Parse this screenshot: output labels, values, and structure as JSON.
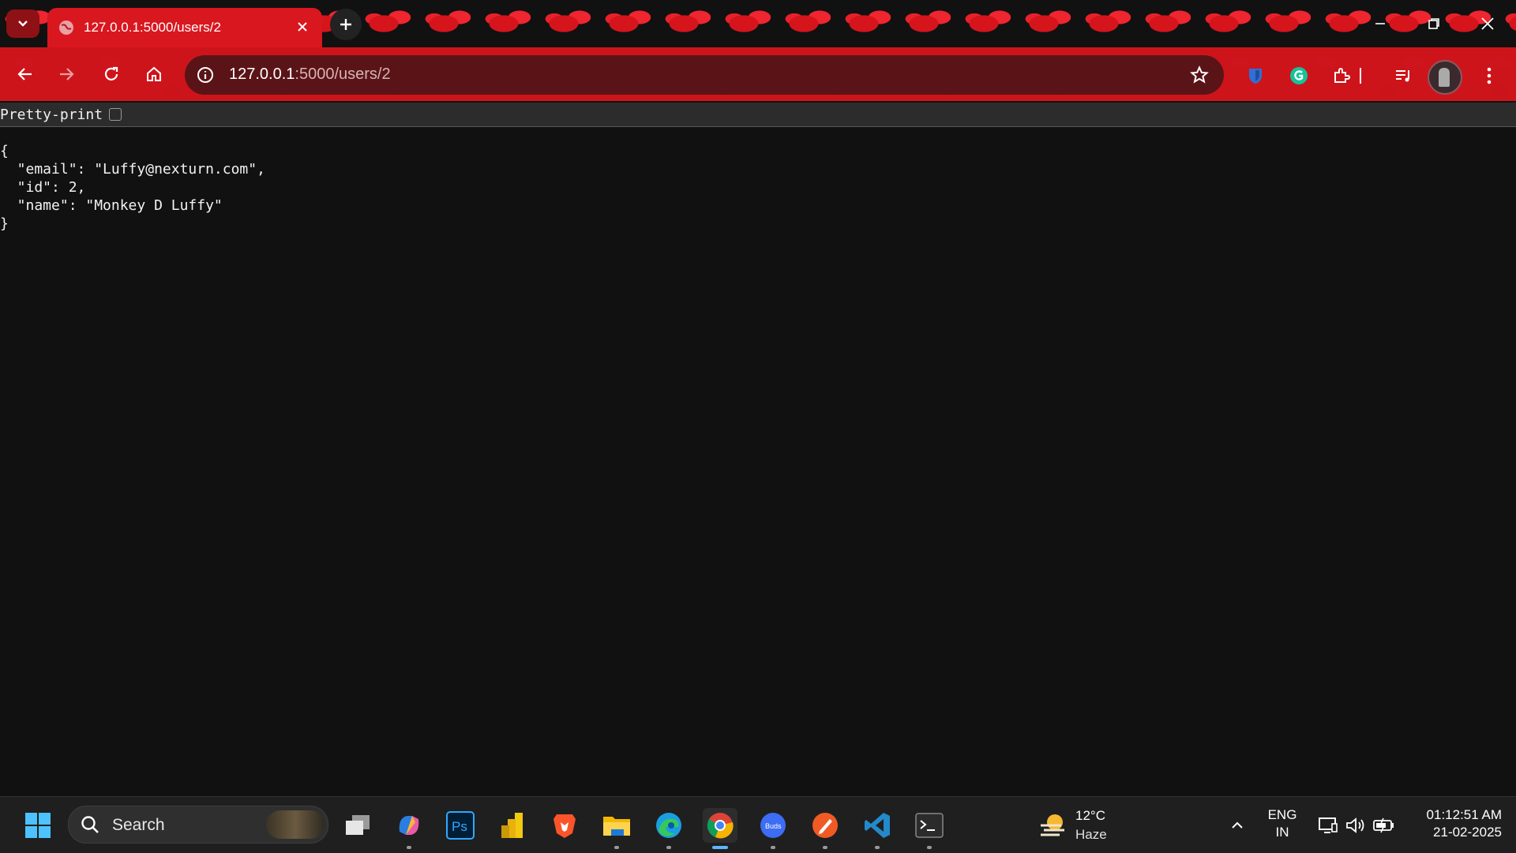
{
  "browser": {
    "tab": {
      "title": "127.0.0.1:5000/users/2"
    },
    "address": {
      "host": "127.0.0.1",
      "path": ":5000/users/2"
    },
    "icons": [
      "tab-search-icon",
      "globe-icon",
      "close-icon",
      "plus-icon",
      "minimize-icon",
      "restore-icon",
      "window-close-icon",
      "back-icon",
      "forward-icon",
      "reload-icon",
      "home-icon",
      "info-icon",
      "star-icon",
      "bitwarden-icon",
      "grammarly-icon",
      "extensions-icon",
      "media-control-icon",
      "profile-avatar",
      "menu-icon"
    ]
  },
  "page": {
    "pretty_print_label": "Pretty-print",
    "json_lines": [
      "{",
      "  \"email\": \"Luffy@nexturn.com\",",
      "  \"id\": 2,",
      "  \"name\": \"Monkey D Luffy\"",
      "}"
    ]
  },
  "taskbar": {
    "search_label": "Search",
    "apps": [
      "start",
      "task-view",
      "copilot",
      "photoshop",
      "power-bi",
      "brave",
      "file-explorer",
      "edge",
      "chrome",
      "galaxy-buds",
      "pen-tool",
      "vscode",
      "terminal"
    ],
    "active_app": "chrome",
    "weather": {
      "temp": "12°C",
      "condition": "Haze"
    },
    "language": {
      "lang": "ENG",
      "region": "IN"
    },
    "clock": {
      "time": "01:12:51 AM",
      "date": "21-02-2025"
    }
  },
  "colors": {
    "chrome_red": "#d9171f",
    "page_bg": "#111111",
    "omnibox": "#5a1418",
    "taskbar": "#1f1f1f"
  }
}
